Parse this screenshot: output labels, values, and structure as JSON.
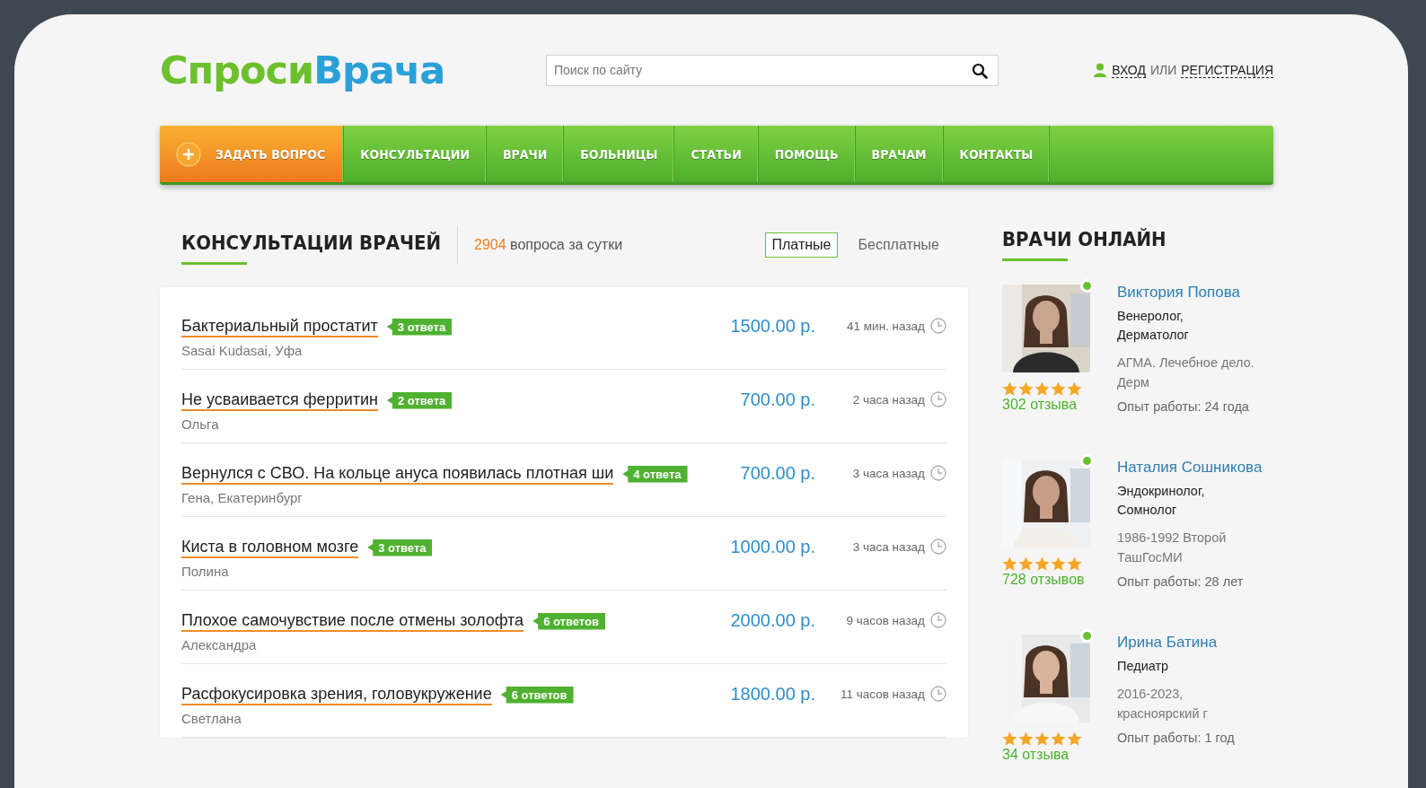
{
  "logo": {
    "part_1": "Спроси",
    "part_2": "Врача"
  },
  "search": {
    "placeholder": "Поиск по сайту"
  },
  "auth": {
    "login": "ВХОД",
    "separator": "ИЛИ",
    "register": "РЕГИСТРАЦИЯ"
  },
  "nav": [
    {
      "label": "ЗАДАТЬ ВОПРОС",
      "kind": "action"
    },
    {
      "label": "КОНСУЛЬТАЦИИ",
      "kind": "link"
    },
    {
      "label": "ВРАЧИ",
      "kind": "link"
    },
    {
      "label": "БОЛЬНИЦЫ",
      "kind": "link"
    },
    {
      "label": "СТАТЬИ",
      "kind": "link"
    },
    {
      "label": "ПОМОЩЬ",
      "kind": "link"
    },
    {
      "label": "ВРАЧАМ",
      "kind": "link"
    },
    {
      "label": "КОНТАКТЫ",
      "kind": "link"
    }
  ],
  "consultations": {
    "title": "КОНСУЛЬТАЦИИ ВРАЧЕЙ",
    "count": "2904",
    "count_label": "вопроса за сутки",
    "filters": [
      {
        "label": "Платные",
        "selected": true
      },
      {
        "label": "Бесплатные",
        "selected": false
      }
    ],
    "questions": [
      {
        "title": "Бактериальный простатит",
        "answers": "3 ответа",
        "author": "Sasai Kudasai, Уфа",
        "price": "1500.00 р.",
        "time": "41 мин. назад"
      },
      {
        "title": "Не усваивается ферритин",
        "answers": "2 ответа",
        "author": "Ольга",
        "price": "700.00 р.",
        "time": "2 часа назад"
      },
      {
        "title": "Вернулся с СВО. На кольце ануса появилась плотная ши",
        "answers": "4 ответа",
        "author": "Гена, Екатеринбург",
        "price": "700.00 р.",
        "time": "3 часа назад"
      },
      {
        "title": "Киста в головном мозге",
        "answers": "3 ответа",
        "author": "Полина",
        "price": "1000.00 р.",
        "time": "3 часа назад"
      },
      {
        "title": "Плохое самочувствие после отмены золофта",
        "answers": "6 ответов",
        "author": "Александра",
        "price": "2000.00 р.",
        "time": "9 часов назад"
      },
      {
        "title": "Расфокусировка зрения, головукружение",
        "answers": "6 ответов",
        "author": "Светлана",
        "price": "1800.00 р.",
        "time": "11 часов назад"
      }
    ]
  },
  "doctors_online": {
    "title": "ВРАЧИ ОНЛАЙН",
    "doctors": [
      {
        "name": "Виктория Попова",
        "online": true,
        "specialties": [
          "Венеролог,",
          "Дерматолог"
        ],
        "education": "АГМА. Лечебное дело. Дерм",
        "stars": 5,
        "reviews": "302 отзыва",
        "experience": "Опыт работы: 24 года"
      },
      {
        "name": "Наталия Сошникова",
        "online": true,
        "specialties": [
          "Эндокринолог,",
          "Сомнолог"
        ],
        "education": "1986-1992 Второй ТашГосМИ",
        "stars": 5,
        "reviews": "728 отзывов",
        "experience": "Опыт работы: 28 лет"
      },
      {
        "name": "Ирина Батина",
        "online": true,
        "specialties": [
          "Педиатр"
        ],
        "education": "2016-2023, красноярский г",
        "stars": 5,
        "reviews": "34 отзыва",
        "experience": "Опыт работы: 1 год"
      }
    ]
  }
}
